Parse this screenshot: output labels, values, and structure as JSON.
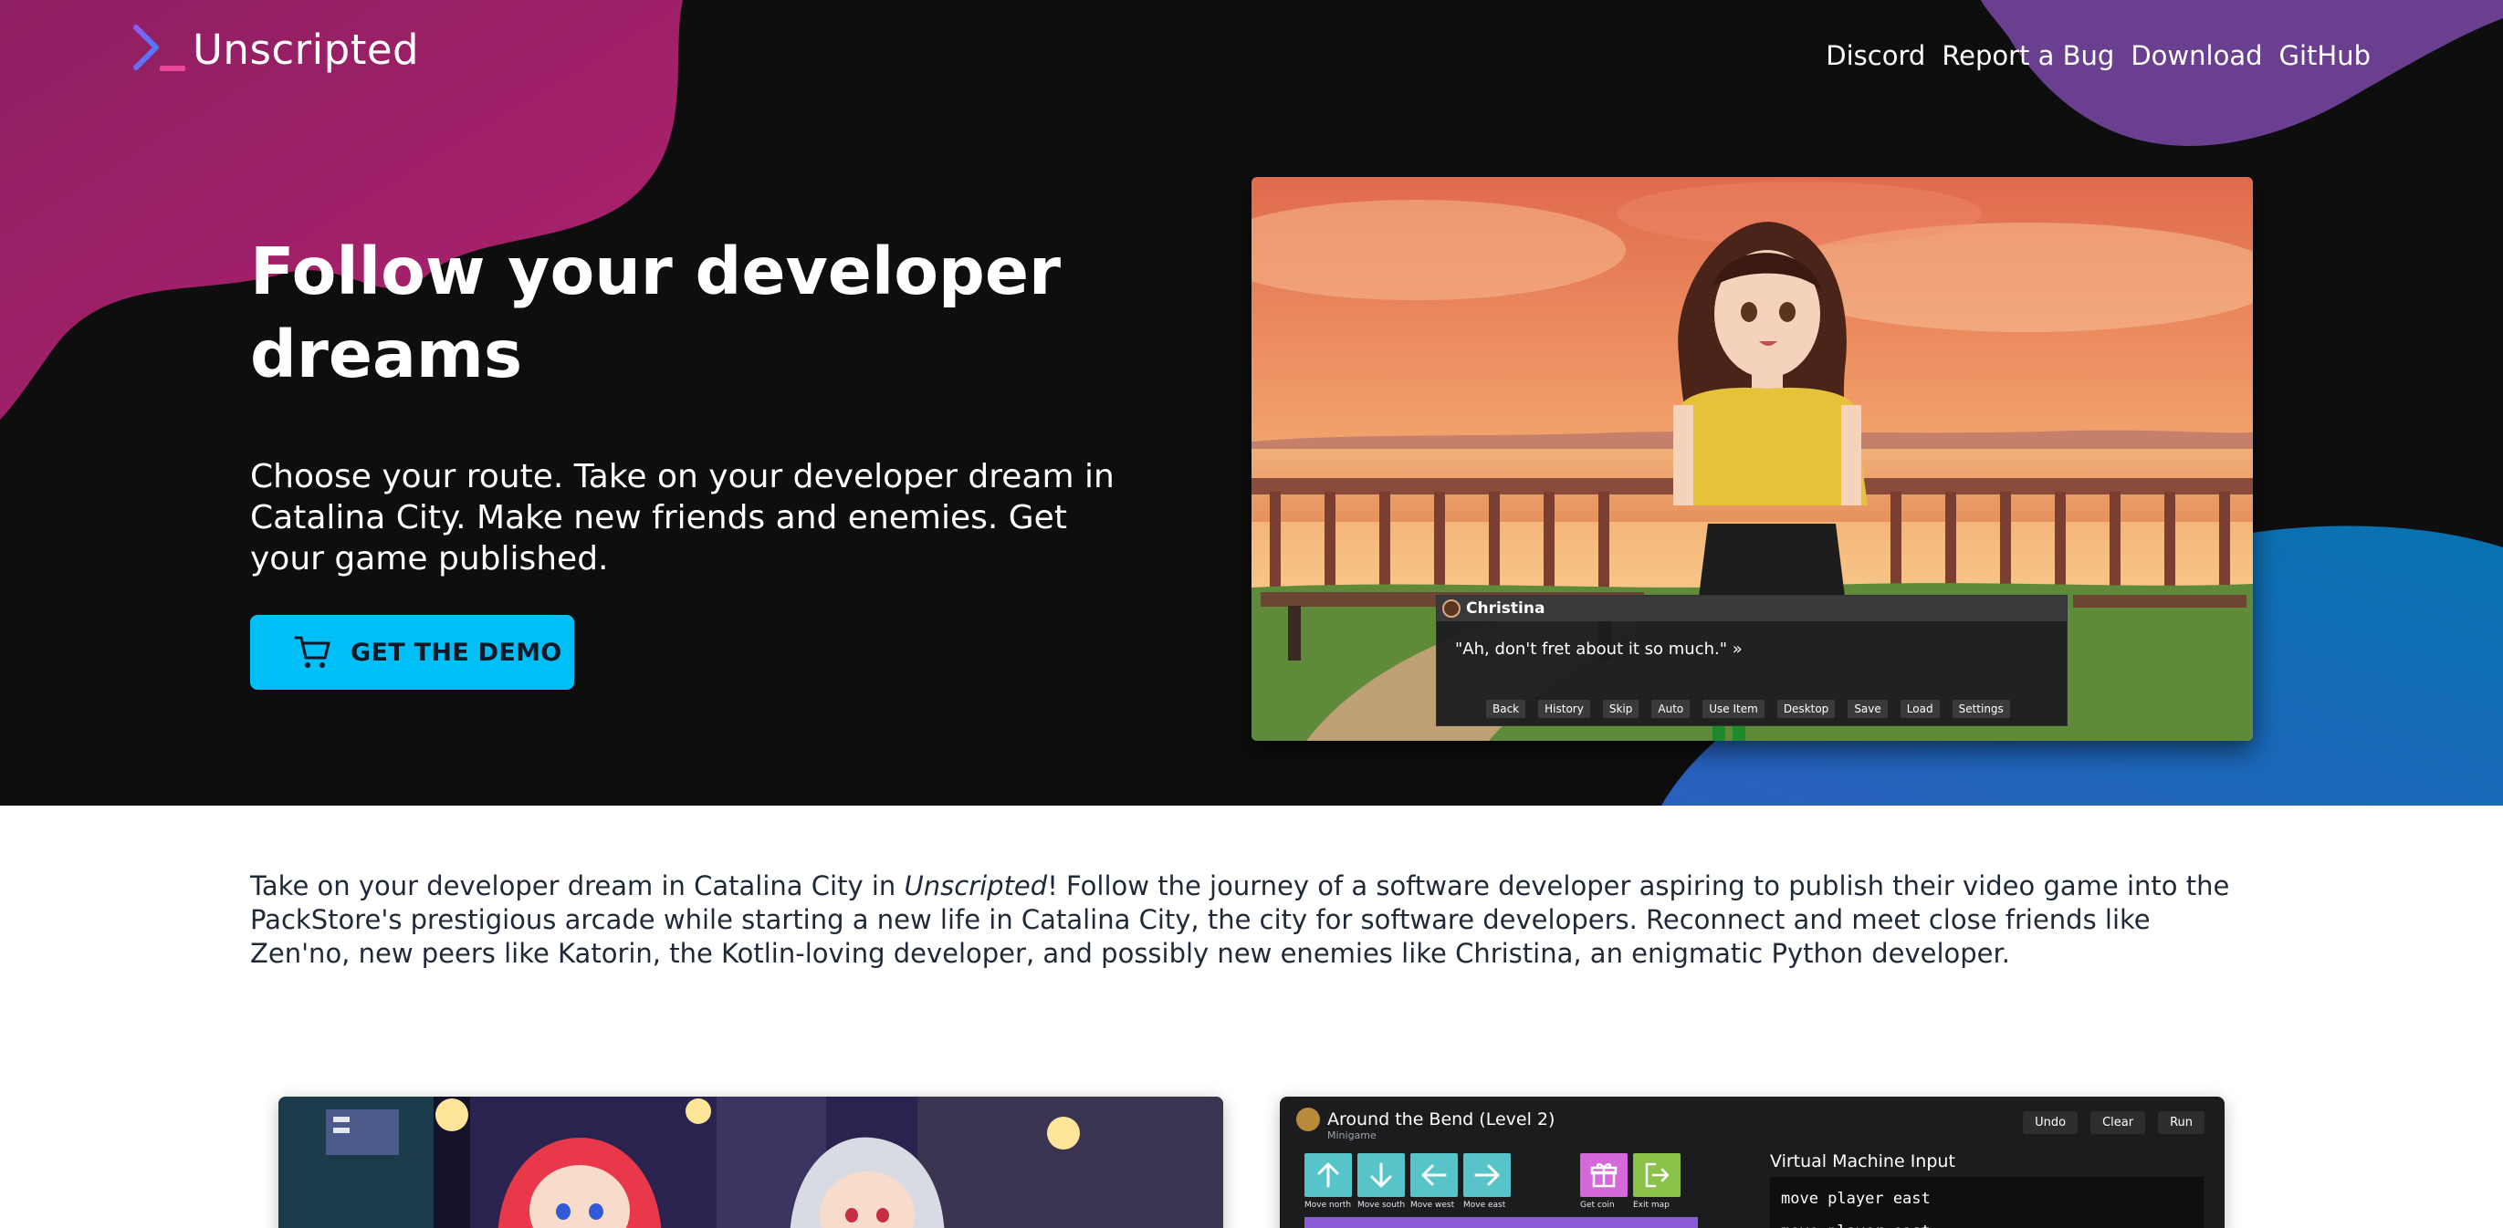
{
  "brand": {
    "name": "Unscripted",
    "logo_icon": "terminal-prompt-icon"
  },
  "nav": {
    "items": [
      {
        "label": "Discord"
      },
      {
        "label": "Report a Bug"
      },
      {
        "label": "Download"
      },
      {
        "label": "GitHub"
      }
    ]
  },
  "hero": {
    "headline": "Follow your developer dreams",
    "subline": "Choose your route. Take on your developer dream in Catalina City. Make new friends and enemies. Get your game published.",
    "cta": {
      "label": "GET THE DEMO",
      "icon": "cart-icon"
    }
  },
  "game_screenshot": {
    "speaker": "Christina",
    "line": "\"Ah, don't fret about it so much.\" »",
    "buttons": [
      "Back",
      "History",
      "Skip",
      "Auto",
      "Use Item",
      "Desktop",
      "Save",
      "Load",
      "Settings"
    ]
  },
  "description": {
    "before": "Take on your developer dream in Catalina City in ",
    "title": "Unscripted",
    "after": "! Follow the journey of a software developer aspiring to publish their video game into the PackStore's prestigious arcade while starting a new life in Catalina City, the city for software developers. Reconnect and meet close friends like Zen'no, new peers like Katorin, the Kotlin-loving developer, and possibly new enemies like Christina, an enigmatic Python developer."
  },
  "minigame": {
    "title": "Around the Bend (Level 2)",
    "subtitle": "Minigame",
    "actions": [
      "Undo",
      "Clear",
      "Run"
    ],
    "controls": [
      {
        "label": "Move north",
        "icon": "arrow-up-icon"
      },
      {
        "label": "Move south",
        "icon": "arrow-down-icon"
      },
      {
        "label": "Move west",
        "icon": "arrow-left-icon"
      },
      {
        "label": "Move east",
        "icon": "arrow-right-icon"
      },
      {
        "label": "Get coin",
        "icon": "gift-icon"
      },
      {
        "label": "Exit map",
        "icon": "exit-icon"
      }
    ],
    "vm_title": "Virtual Machine Input",
    "vm_lines": [
      "move player east",
      "move player east"
    ]
  },
  "colors": {
    "hero_bg": "#0e0e0f",
    "magenta_blob": "#a3206b",
    "purple_blob": "#6a3f8f",
    "blue_blob": "#0a6ba8",
    "cta": "#00bff6"
  }
}
